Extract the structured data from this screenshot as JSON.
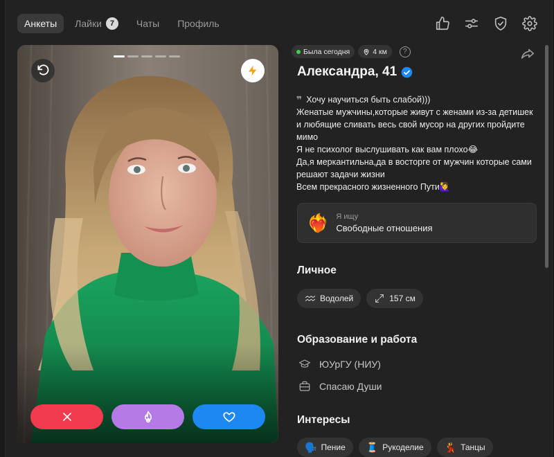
{
  "nav": {
    "tabs": [
      {
        "label": "Анкеты",
        "active": true
      },
      {
        "label": "Лайки",
        "badge": "7"
      },
      {
        "label": "Чаты"
      },
      {
        "label": "Профиль"
      }
    ],
    "icons": [
      "thumbs-up-icon",
      "filters-icon",
      "shield-icon",
      "settings-icon"
    ]
  },
  "photo": {
    "dots_total": 5,
    "dot_active": 0,
    "actions": [
      "dislike",
      "superlike",
      "like"
    ]
  },
  "profile": {
    "status": "Была сегодня",
    "distance": "4 км",
    "help": "?",
    "name": "Александра, 41",
    "bio_quote": "❞",
    "bio_first": "Хочу научиться быть слабой)))",
    "bio_lines": [
      "Женатые мужчины,которые живут с женами из-за детишек и любящие сливать весь свой мусор на других пройдите мимо",
      "Я не психолог выслушивать как вам плохо😂",
      "Да,я меркантильна,да в восторге от мужчин которые сами решают задачи жизни",
      "Всем прекрасного жизненного Пути🙋‍♀️"
    ],
    "looking": {
      "label": "Я ищу",
      "value": "Свободные отношения",
      "emoji": "❤️‍🔥"
    }
  },
  "personal": {
    "title": "Личное",
    "zodiac": "Водолей",
    "height": "157 см"
  },
  "education": {
    "title": "Образование и работа",
    "university": "ЮУрГУ (НИУ)",
    "job": "Спасаю Души"
  },
  "interests": {
    "title": "Интересы",
    "items": [
      {
        "emoji": "🗣️",
        "label": "Пение"
      },
      {
        "emoji": "🧵",
        "label": "Рукоделие"
      },
      {
        "emoji": "💃",
        "label": "Танцы"
      }
    ]
  },
  "colors": {
    "accent_blue": "#1d88f2",
    "dislike_red": "#f23b4f",
    "super_purple": "#b57ae6",
    "online_green": "#3fcf52"
  }
}
